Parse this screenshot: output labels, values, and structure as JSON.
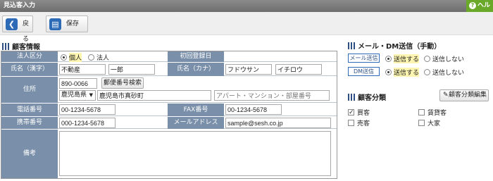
{
  "window": {
    "title": "見込客入力",
    "help_label": "ヘル"
  },
  "toolbar": {
    "back_label": "戻る",
    "save_label": "保存"
  },
  "customer_info": {
    "section_title": "顧客情報",
    "corp_type_label": "法人区分",
    "corp_type_options": [
      "個人",
      "法人"
    ],
    "first_reg_label": "初回登録日",
    "first_reg_value": "",
    "name_kanji_label": "氏名（漢字）",
    "last_name_kanji": "不動産",
    "first_name_kanji": "一郎",
    "name_kana_label": "氏名（カナ）",
    "last_name_kana": "フドウサン",
    "first_name_kana": "イチロウ",
    "address_label": "住所",
    "postal_code": "890-0066",
    "postal_search_label": "郵便番号検索",
    "prefecture": "鹿児島県",
    "city": "鹿児島市真砂町",
    "building_placeholder": "アパート・マンション・部屋番号",
    "phone_label": "電話番号",
    "phone_value": "00-1234-5678",
    "fax_label": "FAX番号",
    "fax_value": "00-1234-5678",
    "mobile_label": "携帯番号",
    "mobile_value": "000-1234-5678",
    "email_label": "メールアドレス",
    "email_value": "sample@sesh.co.jp",
    "notes_label": "備考",
    "notes_value": ""
  },
  "mail_dm": {
    "section_title": "メール・DM送信（手動）",
    "mail_tag": "メール送信",
    "dm_tag": "DM送信",
    "send_label": "送信する",
    "no_send_label": "送信しない"
  },
  "customer_class": {
    "section_title": "顧客分類",
    "edit_button_label": "顧客分類編集",
    "items": [
      {
        "label": "買客",
        "checked": true
      },
      {
        "label": "賃貸客",
        "checked": false
      },
      {
        "label": "売客",
        "checked": false
      },
      {
        "label": "大家",
        "checked": false
      }
    ]
  }
}
